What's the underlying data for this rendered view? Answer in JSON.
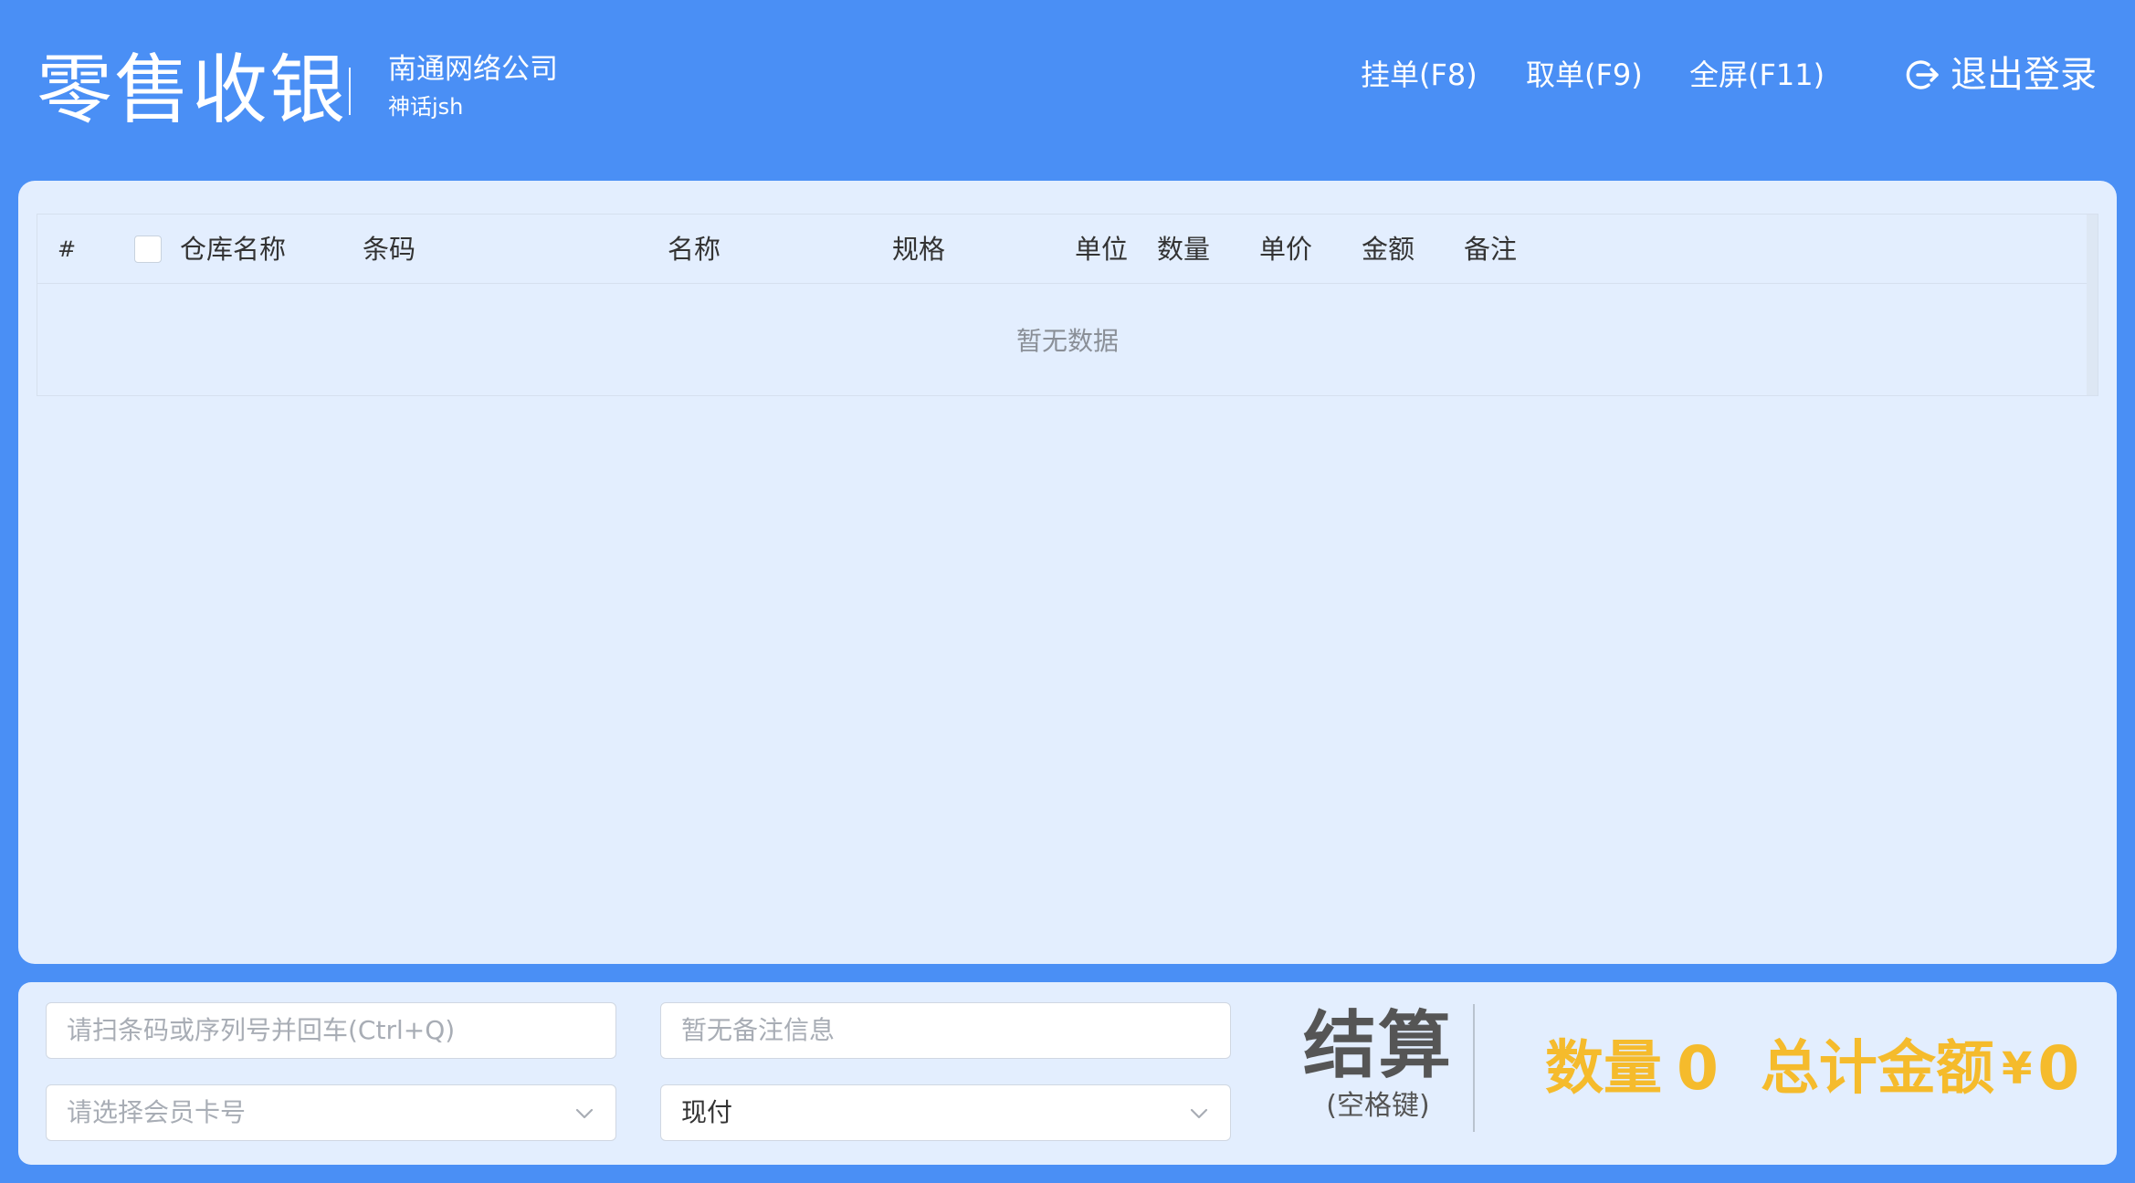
{
  "header": {
    "app_title": "零售收银",
    "company_name": "南通网络公司",
    "user_name": "神话jsh",
    "hold_label": "挂单(F8)",
    "retrieve_label": "取单(F9)",
    "fullscreen_label": "全屏(F11)",
    "logout_label": "退出登录"
  },
  "table": {
    "columns": [
      "#",
      "仓库名称",
      "条码",
      "名称",
      "规格",
      "单位",
      "数量",
      "单价",
      "金额",
      "备注"
    ],
    "empty_text": "暂无数据"
  },
  "footer": {
    "barcode_placeholder": "请扫条码或序列号并回车(Ctrl+Q)",
    "remark_placeholder": "暂无备注信息",
    "member_placeholder": "请选择会员卡号",
    "payment_value": "现付",
    "checkout_label": "结算",
    "checkout_hint": "(空格键)",
    "quantity_label": "数量",
    "quantity_value": "0",
    "total_label": "总计金额",
    "currency": "¥",
    "total_value": "0"
  },
  "colors": {
    "background": "#4a8ff5",
    "panel": "#e3eefe",
    "accent": "#f5bb2c"
  }
}
